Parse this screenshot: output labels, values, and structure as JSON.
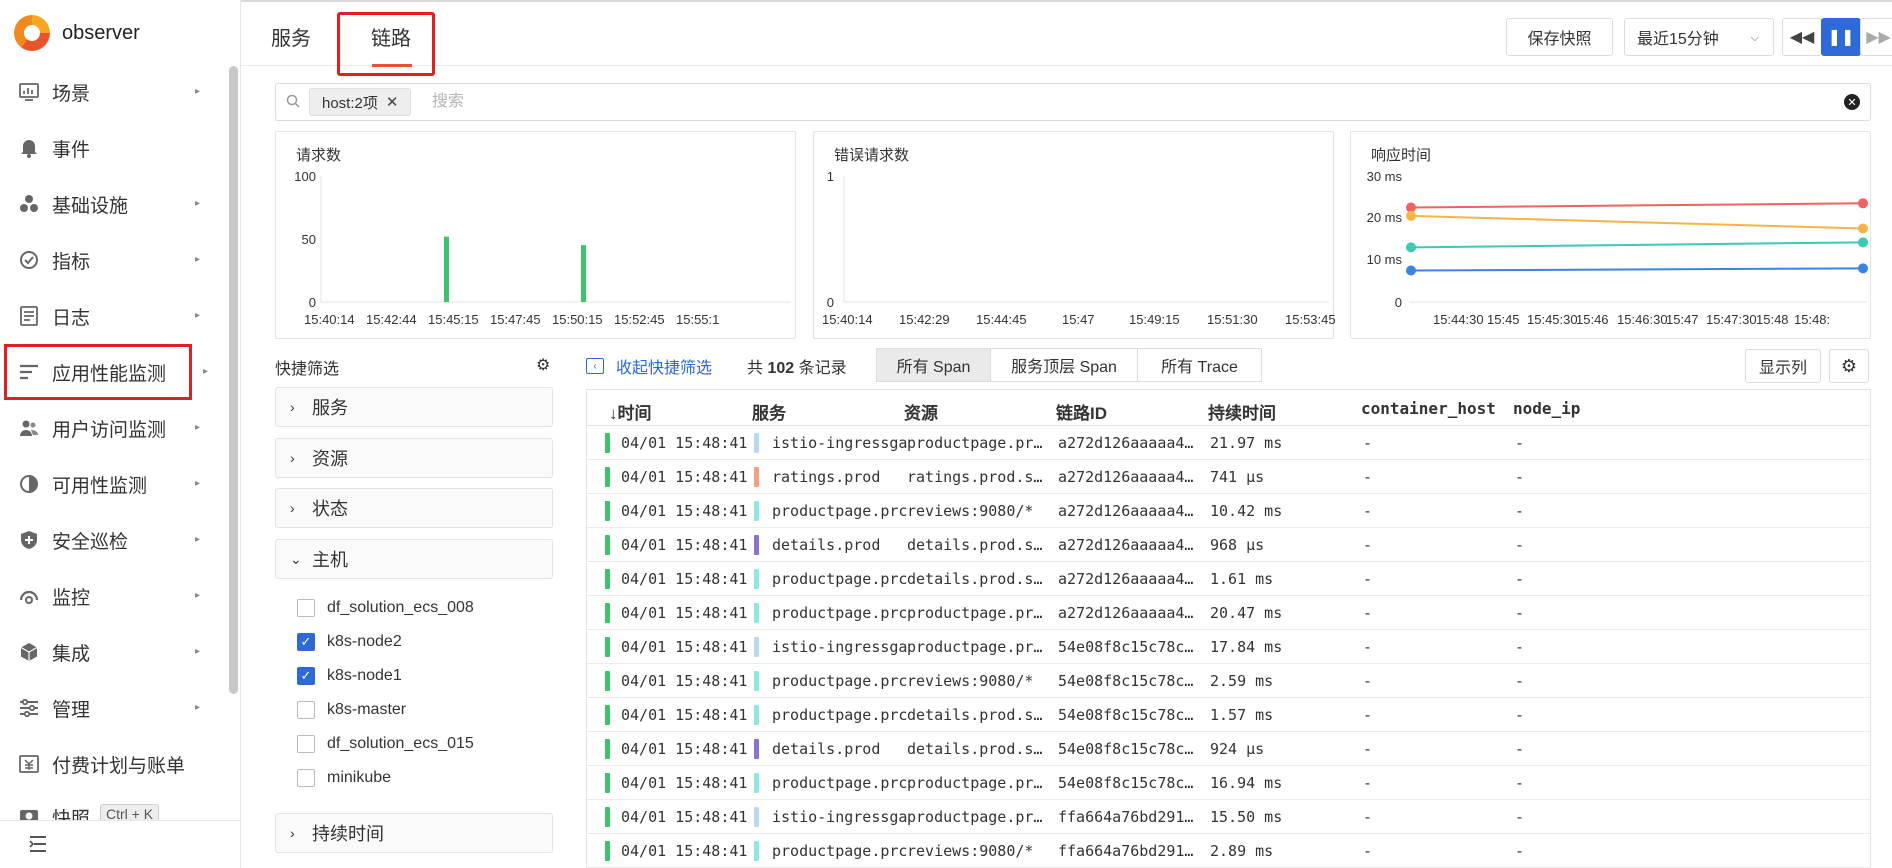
{
  "app": {
    "name": "observer"
  },
  "sidebar": {
    "items": [
      {
        "label": "场景",
        "icon": "dashboard-icon",
        "arrow": true
      },
      {
        "label": "事件",
        "icon": "bell-icon",
        "arrow": false
      },
      {
        "label": "基础设施",
        "icon": "infrastructure-icon",
        "arrow": true
      },
      {
        "label": "指标",
        "icon": "metrics-icon",
        "arrow": true
      },
      {
        "label": "日志",
        "icon": "log-icon",
        "arrow": true
      },
      {
        "label": "应用性能监测",
        "icon": "apm-icon",
        "arrow": true
      },
      {
        "label": "用户访问监测",
        "icon": "rum-icon",
        "arrow": true
      },
      {
        "label": "可用性监测",
        "icon": "availability-icon",
        "arrow": true
      },
      {
        "label": "安全巡检",
        "icon": "shield-icon",
        "arrow": true
      },
      {
        "label": "监控",
        "icon": "monitor-icon",
        "arrow": true
      },
      {
        "label": "集成",
        "icon": "integration-icon",
        "arrow": true
      },
      {
        "label": "管理",
        "icon": "settings-icon",
        "arrow": true
      },
      {
        "label": "付费计划与账单",
        "icon": "billing-icon",
        "arrow": false
      },
      {
        "label": "快照",
        "shortcut": "Ctrl + K",
        "icon": "snapshot-icon",
        "arrow": false
      }
    ]
  },
  "top_tabs": {
    "service": "服务",
    "trace": "链路"
  },
  "toolbar": {
    "save_snapshot": "保存快照",
    "time_range": "最近15分钟"
  },
  "search": {
    "chip": "host:2项",
    "placeholder": "搜索"
  },
  "charts": {
    "requests": {
      "title": "请求数"
    },
    "errors": {
      "title": "错误请求数"
    },
    "response_time": {
      "title": "响应时间"
    }
  },
  "chart_data": [
    {
      "type": "bar",
      "title": "请求数",
      "x_ticks": [
        "15:40:14",
        "15:42:44",
        "15:45:15",
        "15:47:45",
        "15:50:15",
        "15:52:45",
        "15:55:1"
      ],
      "y_ticks": [
        "100",
        "50",
        "0"
      ],
      "ylim": [
        0,
        100
      ],
      "bars": [
        {
          "x": "15:44:45",
          "value": 54
        },
        {
          "x": "15:48:28",
          "value": 47
        }
      ],
      "color": "#3cc36b"
    },
    {
      "type": "bar",
      "title": "错误请求数",
      "x_ticks": [
        "15:40:14",
        "15:42:29",
        "15:44:45",
        "15:47",
        "15:49:15",
        "15:51:30",
        "15:53:45"
      ],
      "y_ticks": [
        "1",
        "0"
      ],
      "ylim": [
        0,
        1
      ],
      "bars": []
    },
    {
      "type": "line",
      "title": "响应时间",
      "x_ticks": [
        "15:44:30",
        "15:45",
        "15:45:30",
        "15:46",
        "15:46:30",
        "15:47",
        "15:47:30",
        "15:48",
        "15:48:"
      ],
      "y_ticks": [
        "30 ms",
        "20 ms",
        "10 ms",
        "0"
      ],
      "ylim": [
        0,
        30
      ],
      "series": [
        {
          "color": "#f0625f",
          "values": [
            22.5,
            23.5
          ]
        },
        {
          "color": "#f7b24a",
          "values": [
            20.5,
            17.5
          ]
        },
        {
          "color": "#3cc9b6",
          "values": [
            13,
            14.2
          ]
        },
        {
          "color": "#3b82e6",
          "values": [
            7.5,
            8
          ]
        }
      ]
    }
  ],
  "quick_filter": {
    "title": "快捷筛选",
    "groups": {
      "service": "服务",
      "resource": "资源",
      "status": "状态",
      "host": "主机",
      "duration": "持续时间"
    },
    "host_options": [
      {
        "label": "df_solution_ecs_008",
        "checked": false
      },
      {
        "label": "k8s-node2",
        "checked": true
      },
      {
        "label": "k8s-node1",
        "checked": true
      },
      {
        "label": "k8s-master",
        "checked": false
      },
      {
        "label": "df_solution_ecs_015",
        "checked": false
      },
      {
        "label": "minikube",
        "checked": false
      }
    ]
  },
  "list_toolbar": {
    "collapse": "收起快捷筛选",
    "count_prefix": "共",
    "count": "102",
    "count_suffix": "条记录",
    "seg_all": "所有 Span",
    "seg_top": "服务顶层 Span",
    "seg_trace": "所有 Trace",
    "show_columns": "显示列"
  },
  "table": {
    "columns": {
      "time": "时间",
      "service": "服务",
      "resource": "资源",
      "trace_id": "链路ID",
      "duration": "持续时间",
      "container_host": "container_host",
      "node_ip": "node_ip"
    },
    "rows": [
      {
        "time": "04/01 15:48:41",
        "svc_color": "#b9d8f2",
        "service": "istio-ingressga",
        "resource": "productpage.pr…",
        "trace": "a272d126aaaaa4…",
        "duration": "21.97 ms",
        "host": "-",
        "ip": "-"
      },
      {
        "time": "04/01 15:48:41",
        "svc_color": "#f2a07f",
        "service": "ratings.prod",
        "resource": "ratings.prod.s…",
        "trace": "a272d126aaaaa4…",
        "duration": "741 μs",
        "host": "-",
        "ip": "-"
      },
      {
        "time": "04/01 15:48:41",
        "svc_color": "#8ce8e4",
        "service": "productpage.prc",
        "resource": "reviews:9080/*",
        "trace": "a272d126aaaaa4…",
        "duration": "10.42 ms",
        "host": "-",
        "ip": "-"
      },
      {
        "time": "04/01 15:48:41",
        "svc_color": "#8d6fd6",
        "service": "details.prod",
        "resource": "details.prod.s…",
        "trace": "a272d126aaaaa4…",
        "duration": "968 μs",
        "host": "-",
        "ip": "-"
      },
      {
        "time": "04/01 15:48:41",
        "svc_color": "#8ce8e4",
        "service": "productpage.prc",
        "resource": "details.prod.s…",
        "trace": "a272d126aaaaa4…",
        "duration": "1.61 ms",
        "host": "-",
        "ip": "-"
      },
      {
        "time": "04/01 15:48:41",
        "svc_color": "#8ce8e4",
        "service": "productpage.prc",
        "resource": "productpage.pr…",
        "trace": "a272d126aaaaa4…",
        "duration": "20.47 ms",
        "host": "-",
        "ip": "-"
      },
      {
        "time": "04/01 15:48:41",
        "svc_color": "#b9d8f2",
        "service": "istio-ingressga",
        "resource": "productpage.pr…",
        "trace": "54e08f8c15c78c…",
        "duration": "17.84 ms",
        "host": "-",
        "ip": "-"
      },
      {
        "time": "04/01 15:48:41",
        "svc_color": "#8ce8e4",
        "service": "productpage.prc",
        "resource": "reviews:9080/*",
        "trace": "54e08f8c15c78c…",
        "duration": "2.59 ms",
        "host": "-",
        "ip": "-"
      },
      {
        "time": "04/01 15:48:41",
        "svc_color": "#8ce8e4",
        "service": "productpage.prc",
        "resource": "details.prod.s…",
        "trace": "54e08f8c15c78c…",
        "duration": "1.57 ms",
        "host": "-",
        "ip": "-"
      },
      {
        "time": "04/01 15:48:41",
        "svc_color": "#8d6fd6",
        "service": "details.prod",
        "resource": "details.prod.s…",
        "trace": "54e08f8c15c78c…",
        "duration": "924 μs",
        "host": "-",
        "ip": "-"
      },
      {
        "time": "04/01 15:48:41",
        "svc_color": "#8ce8e4",
        "service": "productpage.prc",
        "resource": "productpage.pr…",
        "trace": "54e08f8c15c78c…",
        "duration": "16.94 ms",
        "host": "-",
        "ip": "-"
      },
      {
        "time": "04/01 15:48:41",
        "svc_color": "#b9d8f2",
        "service": "istio-ingressga",
        "resource": "productpage.pr…",
        "trace": "ffa664a76bd291…",
        "duration": "15.50 ms",
        "host": "-",
        "ip": "-"
      },
      {
        "time": "04/01 15:48:41",
        "svc_color": "#8ce8e4",
        "service": "productpage.prc",
        "resource": "reviews:9080/*",
        "trace": "ffa664a76bd291…",
        "duration": "2.89 ms",
        "host": "-",
        "ip": "-"
      }
    ]
  },
  "colors": {
    "accent": "#2e6ad6",
    "highlight_red": "#e02020",
    "tab_underline": "#e8542c",
    "status_ok": "#3cc36b"
  }
}
